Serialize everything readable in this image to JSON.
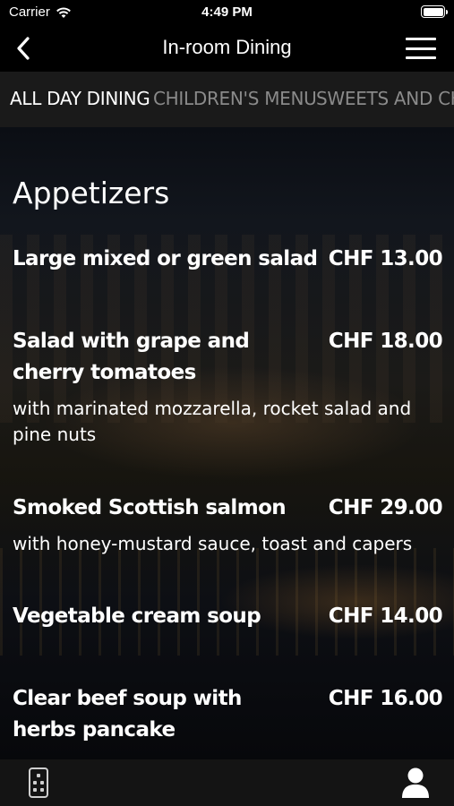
{
  "status_bar": {
    "carrier": "Carrier",
    "time": "4:49 PM"
  },
  "nav": {
    "title": "In-room Dining"
  },
  "tabs": [
    {
      "label": "ALL DAY DINING",
      "active": true
    },
    {
      "label": "CHILDREN'S MENU",
      "active": false
    },
    {
      "label": "SWEETS AND CHE",
      "active": false
    }
  ],
  "section": {
    "title": "Appetizers"
  },
  "items": [
    {
      "name": "Large mixed or green salad",
      "price": "CHF 13.00",
      "description": ""
    },
    {
      "name": "Salad with grape and cherry tomatoes",
      "price": "CHF 18.00",
      "description": "with marinated mozzarella, rocket salad and pine nuts"
    },
    {
      "name": "Smoked Scottish salmon",
      "price": "CHF 29.00",
      "description": "with honey-mustard sauce, toast and capers"
    },
    {
      "name": "Vegetable cream soup",
      "price": "CHF 14.00",
      "description": ""
    },
    {
      "name": "Clear beef soup with herbs pancake",
      "price": "CHF 16.00",
      "description": ""
    }
  ],
  "icons": {
    "back": "chevron-left-icon",
    "menu": "hamburger-menu-icon",
    "remote": "remote-control-icon",
    "profile": "user-profile-icon",
    "wifi": "wifi-icon",
    "battery": "battery-icon"
  }
}
